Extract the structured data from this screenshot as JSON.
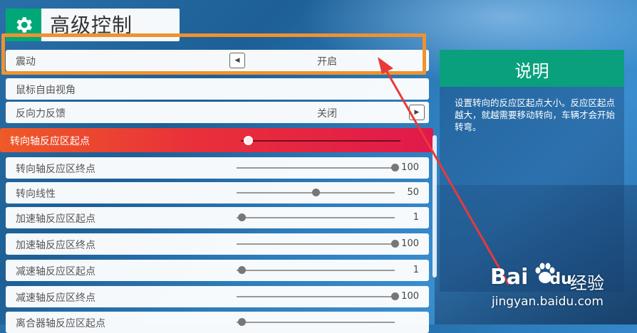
{
  "header": {
    "title": "高级控制",
    "icon": "gear-icon"
  },
  "rows": [
    {
      "label": "震动",
      "value": "开启",
      "type": "toggle"
    },
    {
      "label": "鼠标自由视角",
      "type": "plain"
    },
    {
      "label": "反向力反馈",
      "value": "关闭",
      "type": "toggle"
    },
    {
      "label": "转向轴反应区起点",
      "type": "slider",
      "slider_fraction": 0.04,
      "number": "",
      "active": true
    },
    {
      "label": "转向轴反应区终点",
      "type": "slider",
      "slider_fraction": 1.0,
      "number": "100"
    },
    {
      "label": "转向线性",
      "type": "slider",
      "slider_fraction": 0.5,
      "number": "50"
    },
    {
      "label": "加速轴反应区起点",
      "type": "slider",
      "slider_fraction": 0.03,
      "number": "1"
    },
    {
      "label": "加速轴反应区终点",
      "type": "slider",
      "slider_fraction": 1.0,
      "number": "100"
    },
    {
      "label": "减速轴反应区起点",
      "type": "slider",
      "slider_fraction": 0.03,
      "number": "1"
    },
    {
      "label": "减速轴反应区终点",
      "type": "slider",
      "slider_fraction": 1.0,
      "number": "100"
    },
    {
      "label": "离合器轴反应区起点",
      "type": "slider",
      "slider_fraction": 0.03,
      "number": ""
    }
  ],
  "panel": {
    "title": "说明",
    "body": "设置转向的反应区起点大小。反应区起点越大，就越需要移动转向，车辆才会开始转弯。"
  },
  "watermark": {
    "brand": "Bai",
    "brand2": "du",
    "cn": "经验",
    "url": "jingyan.baidu.com"
  },
  "colors": {
    "accent_green": "#00a878",
    "active_row": "#e8303a",
    "highlight_box": "#f0922e",
    "annotation_arrow": "#e83a3a"
  }
}
